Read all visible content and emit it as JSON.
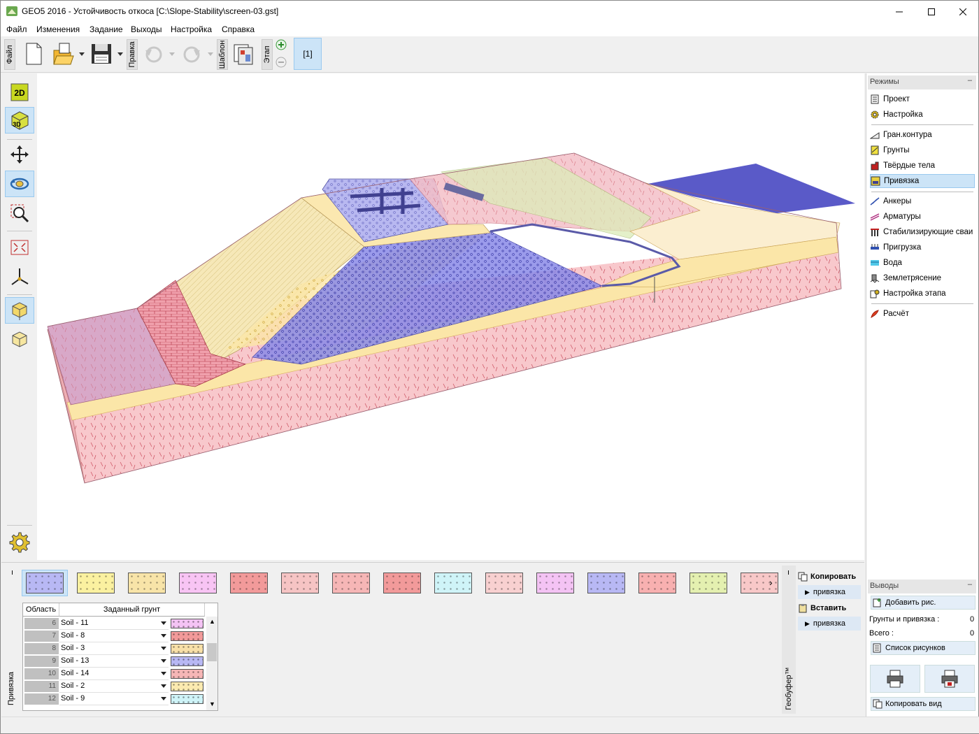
{
  "window": {
    "title": "GEO5 2016 - Устойчивость откоса [C:\\Slope-Stability\\screen-03.gst]",
    "minimize_icon": "minimize-icon",
    "maximize_icon": "maximize-icon",
    "close_icon": "close-icon"
  },
  "menu": [
    "Файл",
    "Изменения",
    "Задание",
    "Выходы",
    "Настройка",
    "Справка"
  ],
  "toolbar": {
    "file_label": "Файл",
    "edit_label": "Правка",
    "template_label": "Шаблон",
    "stage_label": "Этап",
    "stage_tab": "[1]"
  },
  "left_tools": [
    "2d-view-icon",
    "3d-view-icon",
    "move-icon",
    "rotate-icon",
    "zoom-icon",
    "fit-view-icon",
    "axes-icon",
    "box-solid-icon",
    "box-wire-icon",
    "settings-gear-icon"
  ],
  "colors": {
    "accent_selected": "#cce4f7",
    "soil_pink": "#f5b8bc",
    "soil_yellow": "#fbe6a8",
    "soil_blue": "#8080e0",
    "water_plane": "#5a5ac8"
  },
  "modes": {
    "header": "Режимы",
    "group1": [
      "Проект",
      "Настройка"
    ],
    "group2": [
      "Гран.контура",
      "Грунты",
      "Твёрдые тела",
      "Привязка"
    ],
    "group3": [
      "Анкеры",
      "Арматуры",
      "Стабилизирующие сваи",
      "Пригрузка",
      "Вода",
      "Землетрясение",
      "Настройка этапа"
    ],
    "group4": [
      "Расчёт"
    ],
    "selected": "Привязка"
  },
  "outputs": {
    "header": "Выводы",
    "add_picture": "Добавить рис.",
    "soils_assignment_label": "Грунты и привязка :",
    "soils_assignment_value": "0",
    "total_label": "Всего :",
    "total_value": "0",
    "picture_list": "Список рисунков",
    "copy_view": "Копировать вид"
  },
  "assignment": {
    "side_label": "Привязка",
    "col_area": "Область",
    "col_soil": "Заданный грунт",
    "rows": [
      {
        "num": "6",
        "soil": "Soil - 11",
        "color": "#f4c3f4"
      },
      {
        "num": "7",
        "soil": "Soil - 8",
        "color": "#f29a9a"
      },
      {
        "num": "8",
        "soil": "Soil - 3",
        "color": "#f8e0a8"
      },
      {
        "num": "9",
        "soil": "Soil - 13",
        "color": "#b8b8f4"
      },
      {
        "num": "10",
        "soil": "Soil - 14",
        "color": "#f6b6b6"
      },
      {
        "num": "11",
        "soil": "Soil - 2",
        "color": "#fbeab0"
      },
      {
        "num": "12",
        "soil": "Soil - 9",
        "color": "#cff4f8"
      }
    ]
  },
  "swatches": [
    "#b8b8f4",
    "#fbf1a0",
    "#f8e4a8",
    "#f8c4f4",
    "#f29a9a",
    "#f6c4c4",
    "#f6b6b6",
    "#f29a9a",
    "#cff4f8",
    "#f8d0d0",
    "#f4c3f4",
    "#b8b8f4",
    "#f8b0b0",
    "#e4f0b0",
    "#f8c8c8"
  ],
  "geobuffer": {
    "side_label": "Геобуфер™",
    "copy": "Копировать",
    "copy_sub": "привязка",
    "paste": "Вставить",
    "paste_sub": "привязка"
  }
}
